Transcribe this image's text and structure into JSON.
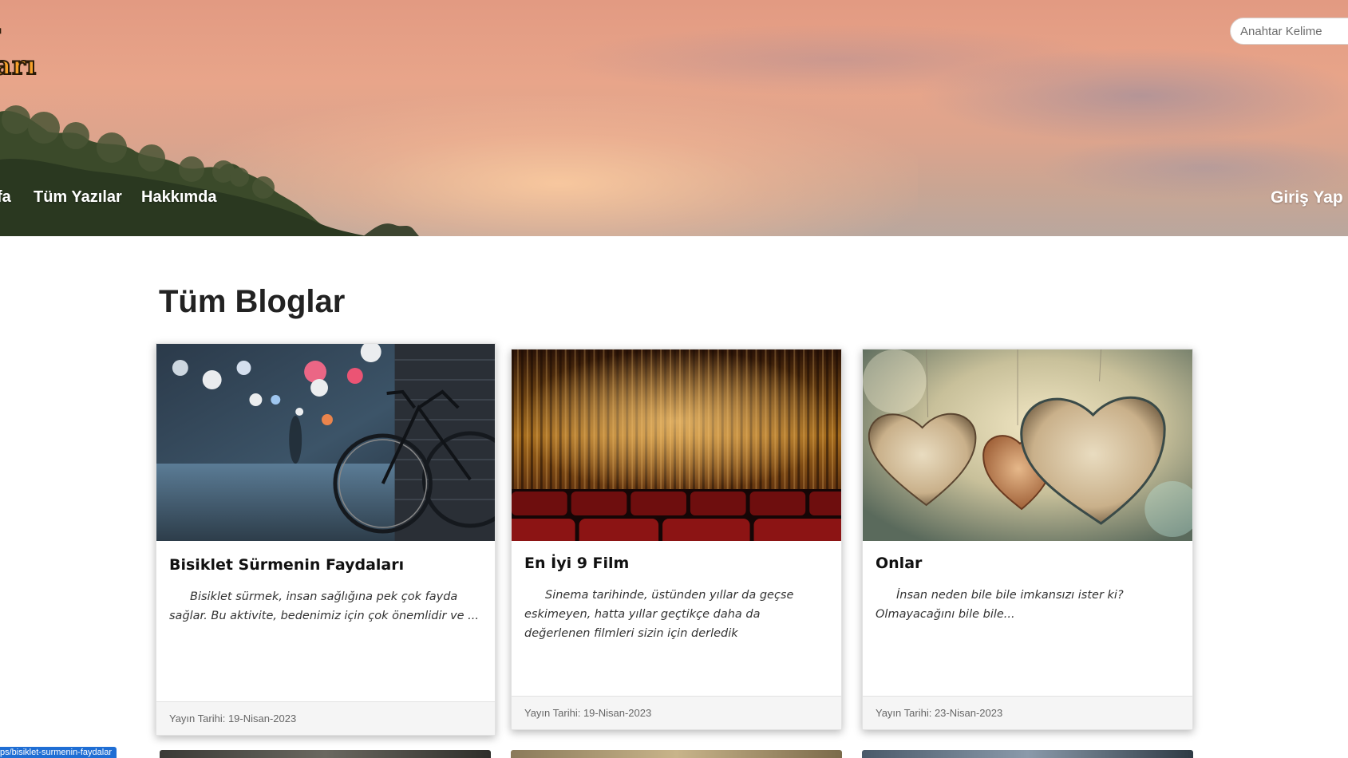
{
  "header": {
    "logo_line1": "ır",
    "logo_line2": "garı",
    "search_placeholder": "Anahtar Kelime",
    "nav": [
      "fa",
      "Tüm Yazılar",
      "Hakkımda"
    ],
    "login_label": "Giriş Yap"
  },
  "main": {
    "page_title": "Tüm Bloglar",
    "cards": [
      {
        "title": "Bisiklet Sürmenin Faydaları",
        "excerpt": "Bisiklet sürmek, insan sağlığına pek çok fayda sağlar. Bu aktivite, bedenimiz için çok önemlidir ve ...",
        "date": "Yayın Tarihi: 19-Nisan-2023",
        "image": "bicycle-photo"
      },
      {
        "title": "En İyi 9 Film",
        "excerpt": "Sinema tarihinde, üstünden yıllar da geçse eskimeyen, hatta yıllar geçtikçe daha da değerlenen filmleri sizin için derledik",
        "date": "Yayın Tarihi: 19-Nisan-2023",
        "image": "cinema-curtain-photo"
      },
      {
        "title": "Onlar",
        "excerpt": "İnsan neden bile bile imkansızı ister ki? Olmayacağını bile bile...",
        "date": "Yayın Tarihi: 23-Nisan-2023",
        "image": "wooden-hearts-photo"
      }
    ]
  },
  "status_bar": {
    "url": "ps/bisiklet-surmenin-faydalar"
  }
}
